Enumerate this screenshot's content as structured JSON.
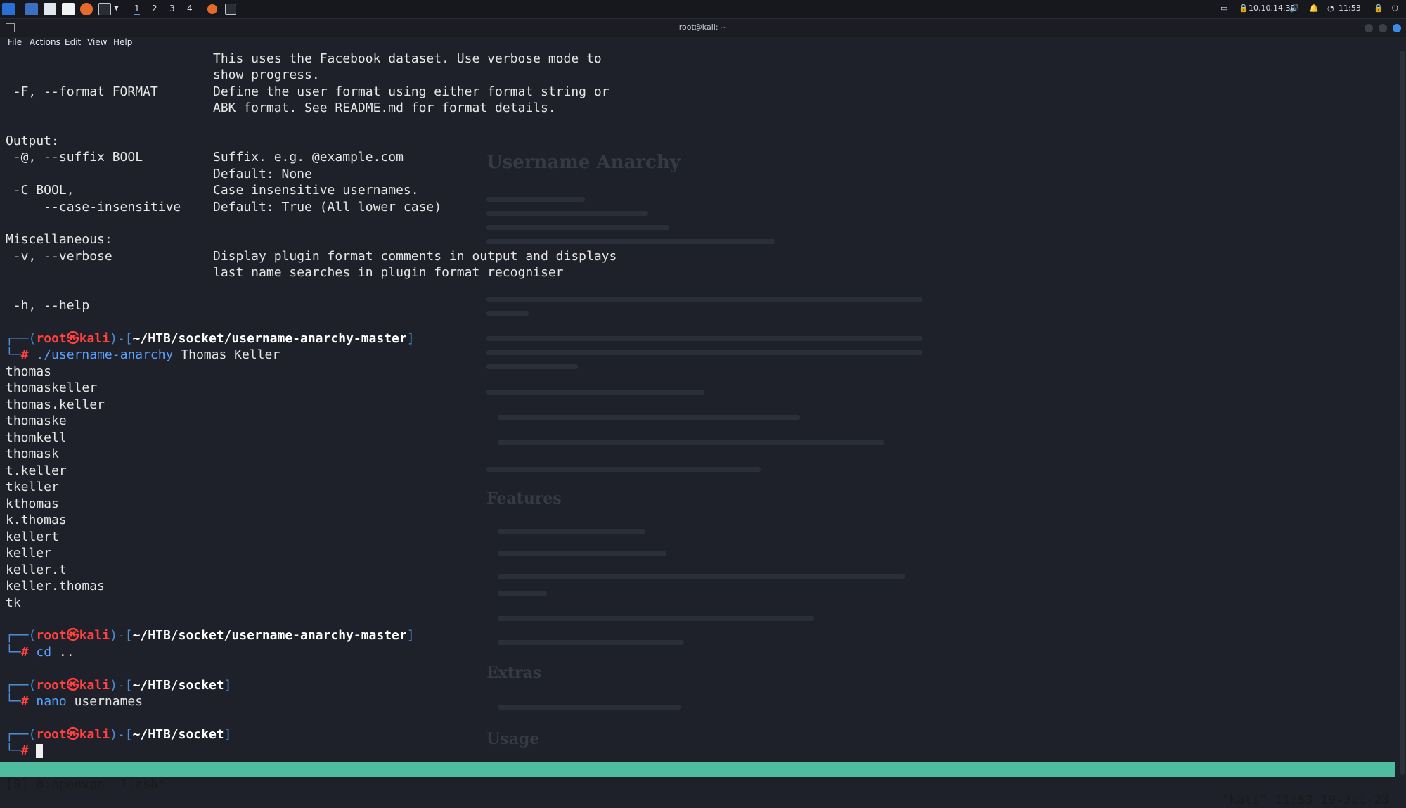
{
  "taskbar": {
    "workspaces": [
      "1",
      "2",
      "3",
      "4"
    ],
    "ip": "10.10.14.31",
    "clock": "11:53"
  },
  "window": {
    "title": "root@kali: ~",
    "menu": [
      "File",
      "Actions",
      "Edit",
      "View",
      "Help"
    ]
  },
  "terminal": {
    "help_lines": [
      {
        "opt": "",
        "desc": "This uses the Facebook dataset. Use verbose mode to"
      },
      {
        "opt": "",
        "desc": "show progress."
      },
      {
        "opt": " -F, --format FORMAT",
        "desc": "Define the user format using either format string or"
      },
      {
        "opt": "",
        "desc": "ABK format. See README.md for format details."
      },
      {
        "opt": "",
        "desc": ""
      },
      {
        "opt": "Output:",
        "desc": ""
      },
      {
        "opt": " -@, --suffix BOOL",
        "desc": "Suffix. e.g. @example.com"
      },
      {
        "opt": "",
        "desc": "Default: None"
      },
      {
        "opt": " -C BOOL,",
        "desc": "Case insensitive usernames."
      },
      {
        "opt": "     --case-insensitive",
        "desc": "Default: True (All lower case)"
      },
      {
        "opt": "",
        "desc": ""
      },
      {
        "opt": "Miscellaneous:",
        "desc": ""
      },
      {
        "opt": " -v, --verbose",
        "desc": "Display plugin format comments in output and displays"
      },
      {
        "opt": "",
        "desc": "last name searches in plugin format recogniser"
      },
      {
        "opt": "",
        "desc": ""
      },
      {
        "opt": " -h, --help",
        "desc": ""
      }
    ],
    "prompt": {
      "user": "root",
      "at": "㉿",
      "host": "kali"
    },
    "commands": [
      {
        "path": "~/HTB/socket/username-anarchy-master",
        "cmd": "./username-anarchy",
        "args": " Thomas Keller"
      },
      {
        "path": "~/HTB/socket/username-anarchy-master",
        "cmd": "cd",
        "args": " .."
      },
      {
        "path": "~/HTB/socket",
        "cmd": "nano",
        "args": " usernames"
      },
      {
        "path": "~/HTB/socket",
        "cmd": "",
        "args": ""
      }
    ],
    "output": [
      "thomas",
      "thomaskeller",
      "thomas.keller",
      "thomaske",
      "thomkell",
      "thomask",
      "t.keller",
      "tkeller",
      "kthomas",
      "k.thomas",
      "kellert",
      "keller",
      "keller.t",
      "keller.thomas",
      "tk"
    ]
  },
  "tmux": {
    "left": "[0] 0:openvpn- 1:zsh*",
    "right": "\"kali\" 11:53 19-Jul-23"
  },
  "background_page": {
    "title": "Username Anarchy",
    "h2_features": "Features",
    "h2_extras": "Extras",
    "h2_usage": "Usage"
  }
}
